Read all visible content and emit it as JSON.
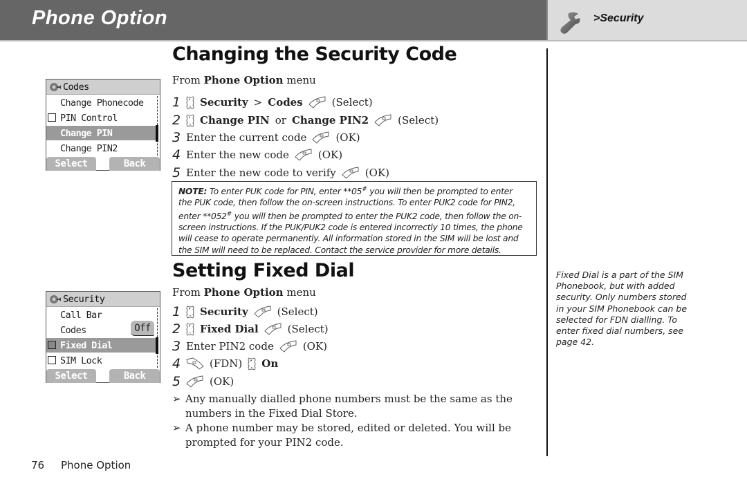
{
  "header": {
    "title": "Phone Option",
    "breadcrumb": ">Security",
    "icon": "wrench-icon"
  },
  "sections": [
    {
      "heading": "Changing the Security Code",
      "from_prefix": "From",
      "from_menu": "Phone Option",
      "from_suffix": "menu",
      "steps": [
        {
          "num": "1",
          "parts": [
            {
              "icon": "nav-key-icon"
            },
            {
              "bold": "Security"
            },
            {
              "text": ">"
            },
            {
              "bold": "Codes"
            },
            {
              "icon": "left-soft-key-icon"
            },
            {
              "text": "(Select)"
            }
          ]
        },
        {
          "num": "2",
          "parts": [
            {
              "icon": "nav-key-icon"
            },
            {
              "bold": "Change PIN"
            },
            {
              "text": "or"
            },
            {
              "bold": "Change PIN2"
            },
            {
              "icon": "left-soft-key-icon"
            },
            {
              "text": "(Select)"
            }
          ]
        },
        {
          "num": "3",
          "parts": [
            {
              "text": "Enter the current code"
            },
            {
              "icon": "left-soft-key-icon"
            },
            {
              "text": "(OK)"
            }
          ]
        },
        {
          "num": "4",
          "parts": [
            {
              "text": "Enter the new code"
            },
            {
              "icon": "left-soft-key-icon"
            },
            {
              "text": "(OK)"
            }
          ]
        },
        {
          "num": "5",
          "parts": [
            {
              "text": "Enter the new code to verify"
            },
            {
              "icon": "left-soft-key-icon"
            },
            {
              "text": "(OK)"
            }
          ]
        }
      ],
      "note": {
        "label": "NOTE:",
        "lines": [
          "To enter PUK code for PIN, enter **05# you will then be prompted to enter",
          "the PUK code, then follow the on-screen instructions. To enter PUK2 code for PIN2,",
          "enter **052# you will then be prompted to enter the PUK2 code, then follow the on-",
          "screen instructions. If the PUK/PUK2 code is entered incorrectly 10 times, the phone",
          "will cease to operate permanently. All information stored in the SIM will be lost and",
          "the SIM will need to be replaced. Contact the service provider for more details."
        ]
      },
      "phone_screen": {
        "title": "Codes",
        "items": [
          {
            "label": "Change Phonecode",
            "checkbox": false,
            "selected": false
          },
          {
            "label": "PIN Control",
            "checkbox": true,
            "selected": false
          },
          {
            "label": "Change PIN",
            "checkbox": false,
            "selected": true
          },
          {
            "label": "Change PIN2",
            "checkbox": false,
            "selected": false
          }
        ],
        "soft_left": "Select",
        "soft_right": "Back"
      }
    },
    {
      "heading": "Setting Fixed Dial",
      "from_prefix": "From",
      "from_menu": "Phone Option",
      "from_suffix": "menu",
      "steps": [
        {
          "num": "1",
          "parts": [
            {
              "icon": "nav-key-icon"
            },
            {
              "bold": "Security"
            },
            {
              "icon": "left-soft-key-icon"
            },
            {
              "text": "(Select)"
            }
          ]
        },
        {
          "num": "2",
          "parts": [
            {
              "icon": "nav-key-icon"
            },
            {
              "bold": "Fixed Dial"
            },
            {
              "icon": "left-soft-key-icon"
            },
            {
              "text": "(Select)"
            }
          ]
        },
        {
          "num": "3",
          "parts": [
            {
              "text": "Enter PIN2 code"
            },
            {
              "icon": "left-soft-key-icon"
            },
            {
              "text": "(OK)"
            }
          ]
        },
        {
          "num": "4",
          "parts": [
            {
              "icon": "right-soft-key-icon"
            },
            {
              "text": "(FDN)"
            },
            {
              "icon": "nav-key-icon"
            },
            {
              "bold": "On"
            }
          ]
        },
        {
          "num": "5",
          "parts": [
            {
              "icon": "left-soft-key-icon"
            },
            {
              "text": "(OK)"
            }
          ]
        }
      ],
      "bullets": [
        {
          "marker": "➢",
          "text": "Any manually dialled phone numbers must be the same as the numbers in the Fixed Dial Store."
        },
        {
          "marker": "➢",
          "text": "A phone number may be stored, edited or deleted. You will be prompted for your PIN2 code."
        }
      ],
      "side_note": "Fixed Dial is a part of the SIM Phonebook, but with added security. Only numbers stored in your SIM Phonebook can be selected for FDN dialling. To enter fixed dial numbers, see page 42.",
      "phone_screen": {
        "title": "Security",
        "items": [
          {
            "label": "Call Bar",
            "checkbox": false,
            "selected": false
          },
          {
            "label": "Codes",
            "checkbox": false,
            "selected": false
          },
          {
            "label": "Fixed Dial",
            "checkbox": true,
            "selected": true
          },
          {
            "label": "SIM Lock",
            "checkbox": true,
            "selected": false
          }
        ],
        "popup_value": "Off",
        "soft_left": "Select",
        "soft_right": "Back"
      }
    }
  ],
  "footer": {
    "page_number": "76",
    "section": "Phone Option"
  }
}
